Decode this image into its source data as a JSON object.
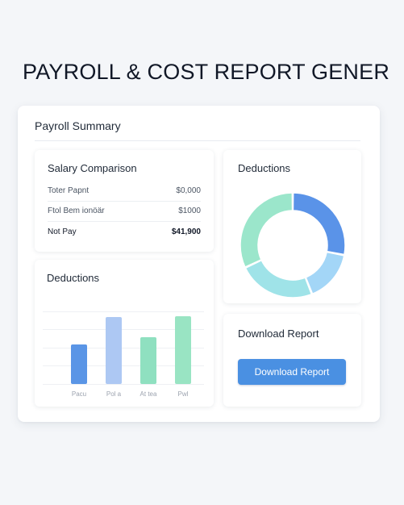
{
  "page": {
    "title": "PAYROLL & COST REPORT GENER"
  },
  "summary": {
    "title": "Payroll Summary"
  },
  "salary_comparison": {
    "title": "Salary Comparison",
    "rows": [
      {
        "label": "Toter Papnt",
        "value": "$0,000"
      },
      {
        "label": "Ftol Bem ionöär",
        "value": "$1000"
      },
      {
        "label": "Not Pay",
        "value": "$41,900"
      }
    ]
  },
  "deductions_bar": {
    "title": "Deductions"
  },
  "deductions_donut": {
    "title": "Deductions"
  },
  "download": {
    "title": "Download Report",
    "button_label": "Download Report"
  },
  "chart_data": [
    {
      "type": "bar",
      "title": "Deductions",
      "categories": [
        "Pacu",
        "Pol a",
        "At tea",
        "Pwl"
      ],
      "values": [
        52,
        88,
        62,
        89
      ],
      "ylim": [
        0,
        100
      ],
      "colors": [
        "#5a95e6",
        "#adc8f3",
        "#8fe0c0",
        "#99e4c3"
      ],
      "grid": true
    },
    {
      "type": "pie",
      "title": "Deductions",
      "values": [
        28,
        16,
        24,
        32
      ],
      "colors": [
        "#5a93e8",
        "#a3d6f7",
        "#9fe3e8",
        "#9be6cb"
      ],
      "hole": true
    }
  ]
}
